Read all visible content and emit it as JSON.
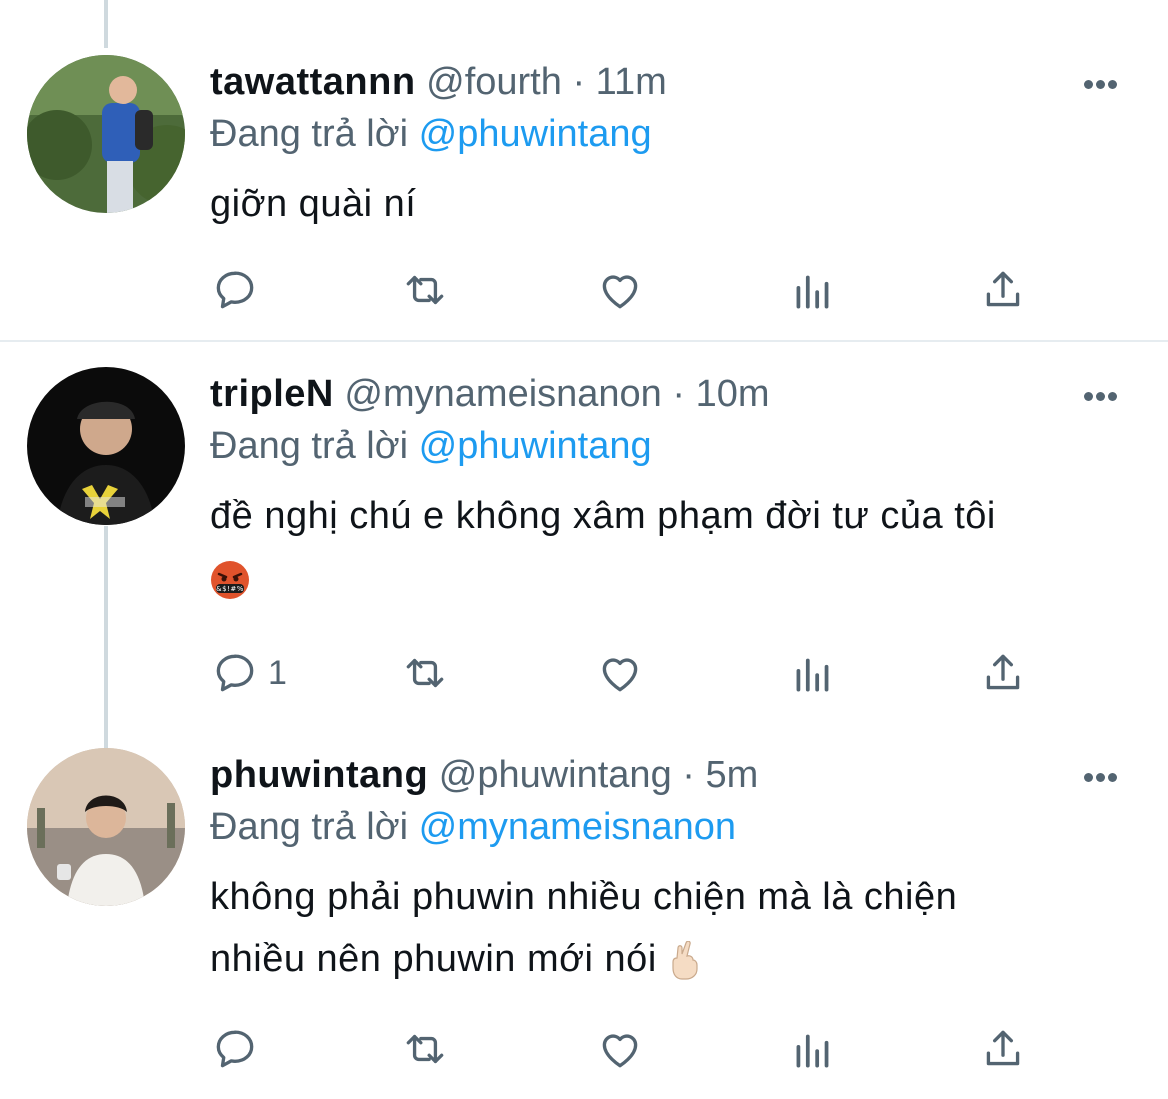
{
  "tweets": [
    {
      "display_name": "tawattannn",
      "handle": "@fourth",
      "separator": "·",
      "time": "11m",
      "replying_prefix": "Đang trả lời",
      "replying_to": "@phuwintang",
      "text_lines": [
        "giỡn quài ní"
      ],
      "reply_count": ""
    },
    {
      "display_name": "tripleN",
      "handle": "@mynameisnanon",
      "separator": "·",
      "time": "10m",
      "replying_prefix": "Đang trả lời",
      "replying_to": "@phuwintang",
      "text_lines": [
        "đề nghị chú e không xâm phạm đời tư của tôi"
      ],
      "emoji": "face-with-symbols-on-mouth",
      "emoji_char": "🤬",
      "reply_count": "1"
    },
    {
      "display_name": "phuwintang",
      "handle": "@phuwintang",
      "separator": "·",
      "time": "5m",
      "replying_prefix": "Đang trả lời",
      "replying_to": "@mynameisnanon",
      "text_lines": [
        "không phải phuwin nhiều chiện mà là chiện",
        "nhiều nên phuwin mới nói"
      ],
      "emoji": "crossed-fingers",
      "emoji_char": "🤞🏻",
      "reply_count": ""
    }
  ],
  "icons": [
    "reply-icon",
    "retweet-icon",
    "like-icon",
    "analytics-icon",
    "share-icon",
    "more-icon"
  ],
  "colors": {
    "text": "#0f1419",
    "secondary": "#536471",
    "link": "#1d9bf0",
    "thread_line": "#cfd9de",
    "emoji_red": "#e0532c"
  }
}
